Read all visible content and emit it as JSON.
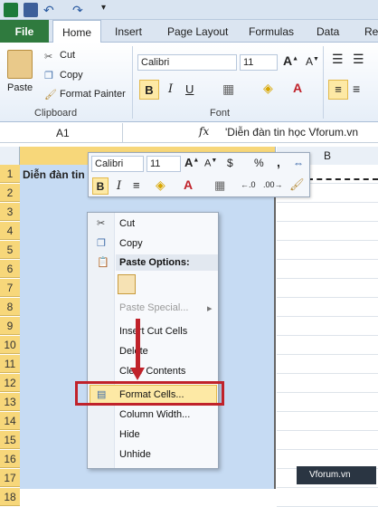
{
  "tabs": {
    "file": "File",
    "home": "Home",
    "insert": "Insert",
    "page_layout": "Page Layout",
    "formulas": "Formulas",
    "data": "Data",
    "review": "Rev"
  },
  "clipboard": {
    "paste": "Paste",
    "cut": "Cut",
    "copy": "Copy",
    "format_painter": "Format Painter",
    "label": "Clipboard"
  },
  "font": {
    "name": "Calibri",
    "size": "11",
    "label": "Font",
    "bold": "B",
    "italic": "I",
    "underline": "U"
  },
  "formula_bar": {
    "cell_ref": "A1",
    "fx": "fx",
    "value": "'Diễn đàn tin học Vforum.vn"
  },
  "grid": {
    "columns": [
      "B"
    ],
    "rows": [
      "1",
      "2",
      "3",
      "4",
      "5",
      "6",
      "7",
      "8",
      "9",
      "10",
      "11",
      "12",
      "13",
      "14",
      "15",
      "16",
      "17",
      "18"
    ],
    "a1_text": "Diễn đàn tin"
  },
  "mini_toolbar": {
    "font": "Calibri",
    "size": "11",
    "currency": "$",
    "percent": "%",
    "comma": ",",
    "bold": "B",
    "italic": "I"
  },
  "context_menu": {
    "cut": "Cut",
    "copy": "Copy",
    "paste_options": "Paste Options:",
    "paste_special": "Paste Special...",
    "insert_cut_cells": "Insert Cut Cells",
    "delete": "Delete",
    "clear_contents": "Clear Contents",
    "format_cells": "Format Cells...",
    "column_width": "Column Width...",
    "hide": "Hide",
    "unhide": "Unhide"
  },
  "watermark": "Vforum.vn",
  "colors": {
    "accent_red": "#c0222a",
    "file_tab": "#2f7a3e",
    "selection": "#c6dbf3",
    "header_selected": "#f7d77a"
  }
}
